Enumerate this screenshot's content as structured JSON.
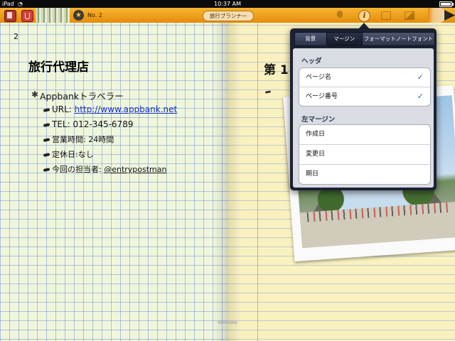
{
  "status_bar": {
    "carrier": "iPad",
    "time": "10:37 AM",
    "battery_level": 1.0
  },
  "toolbar": {
    "page_number_label": "No. 2",
    "notebook_title": "旅行プランナー",
    "icons": [
      "notebook-icon",
      "eraser-icon",
      "star-icon",
      "microphone-icon",
      "info-icon",
      "move-icon",
      "image-icon",
      "pencil-tip-icon"
    ]
  },
  "left_page": {
    "page_number": "2",
    "heading": "旅行代理店",
    "list_title": "Appbankトラベラー",
    "items": {
      "url_label": "URL: ",
      "url_value": "http://www.appbank.net",
      "tel": "TEL: 012-345-6789",
      "hours": "営業時間: 24時間",
      "closed": "定休日:なし",
      "contact_label": "今回の担当者: ",
      "contact_value": "@entrypostman"
    }
  },
  "right_page": {
    "heading": "第 1"
  },
  "popover": {
    "tabs": [
      "背景",
      "マージン",
      "フォーマット",
      "ノートフォント"
    ],
    "active_tab": "マージン",
    "header_section": {
      "title": "ヘッダ",
      "rows": [
        {
          "label": "ページ名",
          "checked": true
        },
        {
          "label": "ページ番号",
          "checked": true
        }
      ]
    },
    "left_margin_section": {
      "title": "左マージン",
      "rows": [
        {
          "label": "作成日",
          "checked": false
        },
        {
          "label": "変更日",
          "checked": false
        },
        {
          "label": "期日",
          "checked": false
        }
      ]
    },
    "check_glyph": "✓"
  }
}
